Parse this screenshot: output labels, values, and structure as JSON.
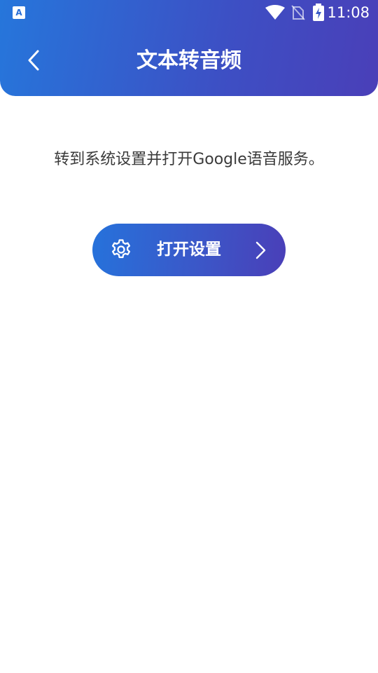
{
  "status_bar": {
    "time": "11:08",
    "app_icon_glyph": "A",
    "icons": [
      "keyboard-app-icon",
      "wifi-icon",
      "no-sim-icon",
      "battery-charging-icon"
    ]
  },
  "header": {
    "title": "文本转音频",
    "back_icon": "chevron-left-icon",
    "gradient_start": "#2676db",
    "gradient_end": "#4a3fb8"
  },
  "main": {
    "instruction": "转到系统设置并打开Google语音服务。",
    "open_settings_button": {
      "label": "打开设置",
      "leading_icon": "gear-icon",
      "trailing_icon": "chevron-right-icon"
    }
  },
  "colors": {
    "accent": "#3b57c8",
    "text": "#3a3a3a",
    "background": "#ffffff"
  }
}
